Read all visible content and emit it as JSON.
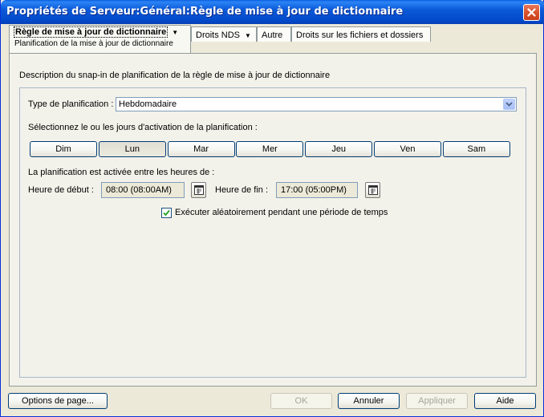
{
  "window": {
    "title": "Propriétés de Serveur:Général:Règle de mise à jour de dictionnaire"
  },
  "tabs": {
    "active": {
      "label": "Règle de mise à jour de dictionnaire",
      "sub_label": "Planification de la mise à jour de dictionnaire"
    },
    "others": [
      {
        "label": "Droits NDS",
        "has_dropdown": true
      },
      {
        "label": "Autre",
        "has_dropdown": false
      },
      {
        "label": "Droits sur les fichiers et dossiers",
        "has_dropdown": false
      }
    ]
  },
  "main": {
    "description": "Description du snap-in de planification de la règle de mise à jour de dictionnaire",
    "schedule_type_label": "Type de planification :",
    "schedule_type_value": "Hebdomadaire",
    "days_label": "Sélectionnez le ou les jours d'activation de la planification :",
    "weekdays": [
      {
        "label": "Dim",
        "pressed": false
      },
      {
        "label": "Lun",
        "pressed": true
      },
      {
        "label": "Mar",
        "pressed": false
      },
      {
        "label": "Mer",
        "pressed": false
      },
      {
        "label": "Jeu",
        "pressed": false
      },
      {
        "label": "Ven",
        "pressed": false
      },
      {
        "label": "Sam",
        "pressed": false
      }
    ],
    "hours_label": "La planification est activée entre les heures de :",
    "start_label": "Heure de début :",
    "start_value": "08:00 (08:00AM)",
    "end_label": "Heure de fin :",
    "end_value": "17:00 (05:00PM)",
    "random_label": "Exécuter aléatoirement pendant une période de temps",
    "random_checked": true
  },
  "footer": {
    "page_options_label": "Options de page...",
    "buttons": [
      {
        "name": "ok-button",
        "label": "OK",
        "enabled": false
      },
      {
        "name": "cancel-button",
        "label": "Annuler",
        "enabled": true
      },
      {
        "name": "apply-button",
        "label": "Appliquer",
        "enabled": false
      },
      {
        "name": "help-button",
        "label": "Aide",
        "enabled": true
      }
    ]
  },
  "colors": {
    "titlebar": "#0b5ad8",
    "dialog_bg": "#ece9d8",
    "close_button": "#d9532d"
  }
}
